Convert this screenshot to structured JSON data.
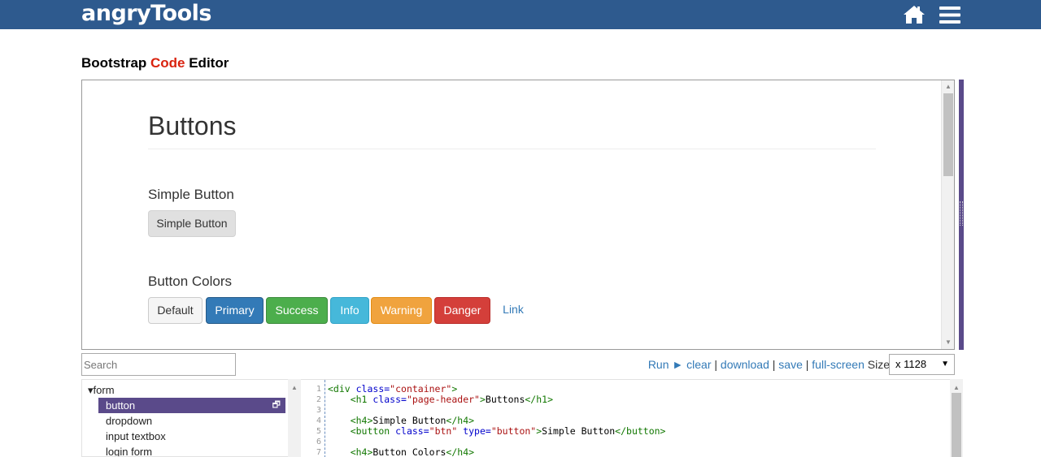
{
  "app": {
    "logo": "angryTools",
    "icons": {
      "home": "home-icon",
      "menu": "hamburger-menu-icon"
    }
  },
  "page": {
    "title_part1": "Bootstrap ",
    "title_part2": "Code",
    "title_part3": " Editor",
    "accent_color": "#d9230f"
  },
  "preview": {
    "heading": "Buttons",
    "section1_title": "Simple Button",
    "simple_button_label": "Simple Button",
    "section2_title": "Button Colors",
    "color_buttons": [
      "Default",
      "Primary",
      "Success",
      "Info",
      "Warning",
      "Danger",
      "Link"
    ]
  },
  "toolbar": {
    "search_placeholder": "Search",
    "run_label": "Run ►",
    "clear_label": "clear",
    "download_label": "download",
    "save_label": "save",
    "fullscreen_label": "full-screen",
    "separator": "|",
    "size_label": "Size",
    "size_value": "x 1128"
  },
  "tree": {
    "folder": "▾form",
    "items": [
      "button",
      "dropdown",
      "input textbox",
      "login form"
    ],
    "selected_index": 0,
    "selection_color": "#5a4a8a"
  },
  "editor": {
    "line_numbers": [
      "1",
      "2",
      "3",
      "4",
      "5",
      "6",
      "7"
    ],
    "line1": {
      "open": "<div ",
      "attr": "class=",
      "val": "\"container\"",
      "close": ">"
    },
    "line2": {
      "indent": "    ",
      "open": "<h1 ",
      "attr": "class=",
      "val": "\"page-header\"",
      "close": ">",
      "text": "Buttons",
      "end": "</h1>"
    },
    "line4": {
      "indent": "    ",
      "open": "<h4>",
      "text": "Simple Button",
      "end": "</h4>"
    },
    "line5": {
      "indent": "    ",
      "open": "<button ",
      "attr1": "class=",
      "val1": "\"btn\"",
      "sp": " ",
      "attr2": "type=",
      "val2": "\"button\"",
      "close": ">",
      "text": "Simple Button",
      "end": "</button>"
    },
    "line7": {
      "indent": "    ",
      "open": "<h4>",
      "text": "Button Colors",
      "end": "</h4>"
    }
  }
}
